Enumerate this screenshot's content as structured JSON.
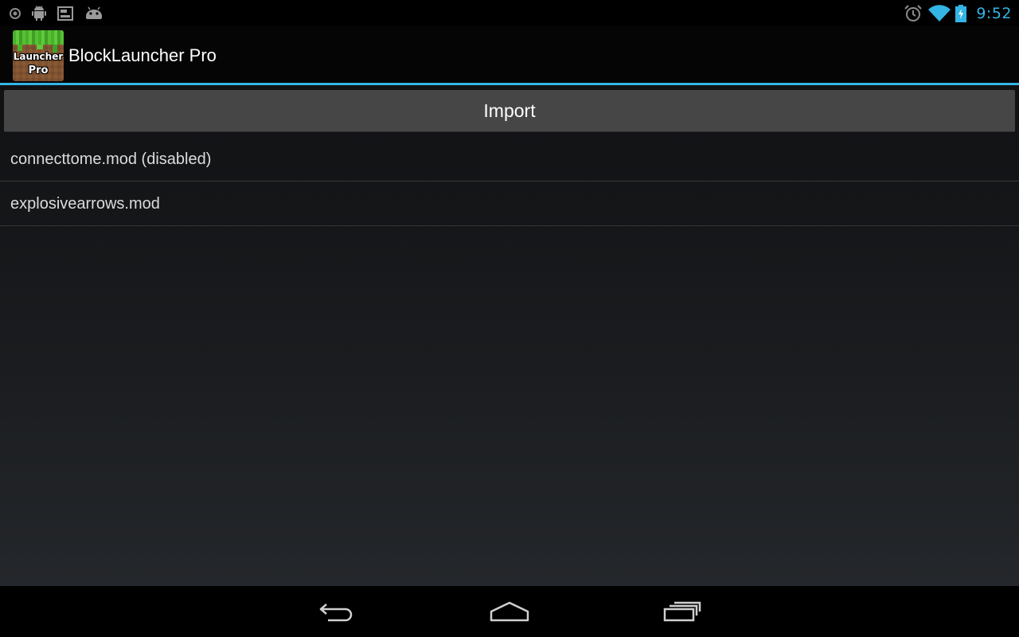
{
  "status_bar": {
    "left_icons": [
      "notification-dot-icon",
      "android-debug-icon",
      "screenshot-icon",
      "android-game-icon"
    ],
    "right_icons": [
      "alarm-icon",
      "wifi-icon",
      "battery-charging-icon"
    ],
    "time": "9:52",
    "accent_color": "#33b5e5"
  },
  "action_bar": {
    "app_icon_text_line1": "Launcher",
    "app_icon_text_line2": "Pro",
    "title": "BlockLauncher Pro",
    "divider_color": "#33b5e5"
  },
  "content": {
    "import_button_label": "Import",
    "mods": [
      {
        "label": "connecttome.mod (disabled)"
      },
      {
        "label": "explosivearrows.mod"
      }
    ]
  },
  "nav_bar": {
    "buttons": [
      "back-icon",
      "home-icon",
      "recent-apps-icon"
    ]
  }
}
